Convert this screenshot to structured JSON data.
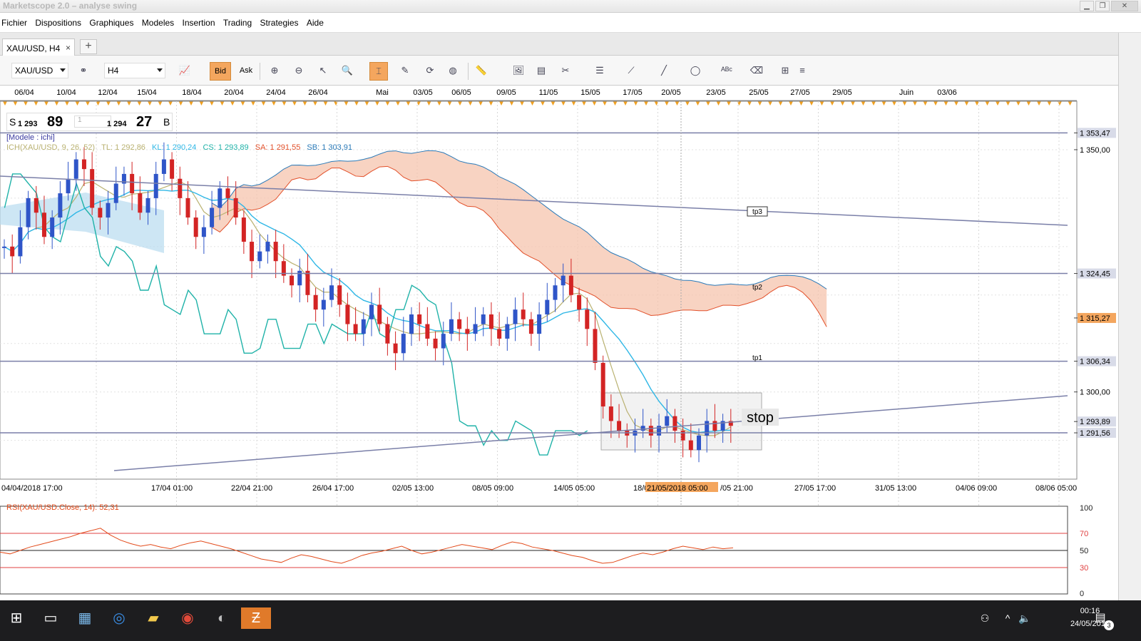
{
  "window": {
    "title": "Marketscope 2.0 – analyse swing"
  },
  "menu": [
    "Fichier",
    "Dispositions",
    "Graphiques",
    "Modeles",
    "Insertion",
    "Trading",
    "Strategies",
    "Aide"
  ],
  "tab": {
    "label": "XAU/USD, H4",
    "close": "×",
    "add": "+"
  },
  "toolbar": {
    "instrument": "XAU/USD",
    "timeframe": "H4",
    "bid_label": "Bid",
    "ask_label": "Ask"
  },
  "quote": {
    "sell_prefix": "S",
    "sell_small": "1 293",
    "sell_big": "89",
    "amount": "1",
    "buy_small": "1 294",
    "buy_big": "27",
    "buy_suffix": "B"
  },
  "indicator_labels": {
    "model": "[Modele : ichi]",
    "ichimoku": "ICH(XAU/USD, 9, 26, 52)",
    "tl": "TL: 1 292,86",
    "kl": "KL: 1 290,24",
    "cs": "CS: 1 293,89",
    "sa": "SA: 1 291,55",
    "sb": "SB: 1 303,91",
    "rsi": "RSI(XAU/USD.Close, 14): 52,31"
  },
  "top_dates": [
    "06/04",
    "10/04",
    "12/04",
    "15/04",
    "18/04",
    "20/04",
    "24/04",
    "26/04",
    "Mai",
    "03/05",
    "06/05",
    "09/05",
    "11/05",
    "15/05",
    "17/05",
    "20/05",
    "23/05",
    "25/05",
    "27/05",
    "29/05",
    "Juin",
    "03/06"
  ],
  "bottom_dates": [
    "04/04/2018 17:00",
    "17/04 01:00",
    "22/04 21:00",
    "26/04 17:00",
    "02/05 13:00",
    "08/05 09:00",
    "14/05 05:00",
    "18/05",
    "21/05/2018 05:00",
    "/05 21:00",
    "27/05 17:00",
    "31/05 13:00",
    "04/06 09:00",
    "08/06 05:00"
  ],
  "price_labels": [
    "1 353,47",
    "1 350,00",
    "1 324,45",
    "1 315,27",
    "1 306,34",
    "1 300,00",
    "1 293,89",
    "1 291,56"
  ],
  "rsi_labels": [
    "100",
    "70",
    "50",
    "30",
    "0"
  ],
  "annotations": {
    "tp3": "tp3",
    "tp2": "tp2",
    "tp1": "tp1",
    "stop": "stop"
  },
  "taskbar": {
    "time": "00:16",
    "date": "24/05/2018",
    "notif": "3"
  },
  "colors": {
    "bull": "#2f55c8",
    "bear": "#d32424",
    "tenkan": "#b9b170",
    "kijun": "#2fb7e6",
    "chikou": "#1fb2a8",
    "kumo_bear": "#f5c4ad",
    "kumo_bull": "#b8dcf0",
    "hline": "#7a7fa8",
    "rsi": "#e24a1a",
    "accent": "#f4a65e"
  },
  "chart_data": {
    "type": "candlestick",
    "instrument": "XAU/USD",
    "timeframe": "H4",
    "ylim": [
      1282,
      1360
    ],
    "horizontal_lines": [
      {
        "label": "tp3",
        "value": 1353.47
      },
      {
        "label": "tp2",
        "value": 1324.45
      },
      {
        "label": "tp1",
        "value": 1306.34
      },
      {
        "label": "stop",
        "value": 1291.56
      }
    ],
    "close_series": [
      1330,
      1328,
      1334,
      1340,
      1337,
      1332,
      1336,
      1341,
      1344,
      1348,
      1346,
      1338,
      1336,
      1339,
      1343,
      1345,
      1341,
      1337,
      1340,
      1345,
      1348,
      1344,
      1340,
      1336,
      1332,
      1334,
      1338,
      1342,
      1340,
      1336,
      1331,
      1327,
      1329,
      1331,
      1327,
      1324,
      1322,
      1325,
      1320,
      1317,
      1319,
      1322,
      1318,
      1314,
      1312,
      1315,
      1318,
      1314,
      1310,
      1308,
      1312,
      1316,
      1314,
      1311,
      1309,
      1312,
      1315,
      1313,
      1312,
      1314,
      1316,
      1313,
      1311,
      1314,
      1317,
      1315,
      1312,
      1316,
      1319,
      1322,
      1324,
      1320,
      1317,
      1313,
      1306,
      1297,
      1294,
      1292,
      1291,
      1292,
      1293,
      1291,
      1293,
      1295,
      1292,
      1290,
      1288,
      1291,
      1294,
      1292,
      1294,
      1293
    ],
    "rsi_series": [
      48,
      46,
      50,
      54,
      57,
      60,
      63,
      66,
      70,
      73,
      76,
      68,
      62,
      58,
      55,
      57,
      54,
      52,
      56,
      59,
      61,
      58,
      55,
      52,
      48,
      44,
      40,
      38,
      36,
      41,
      45,
      43,
      40,
      37,
      35,
      39,
      44,
      47,
      49,
      52,
      55,
      50,
      46,
      48,
      51,
      54,
      57,
      55,
      53,
      51,
      56,
      60,
      58,
      54,
      52,
      50,
      47,
      44,
      42,
      38,
      35,
      36,
      40,
      44,
      47,
      45,
      48,
      52,
      55,
      53,
      51,
      54,
      52,
      53
    ]
  }
}
